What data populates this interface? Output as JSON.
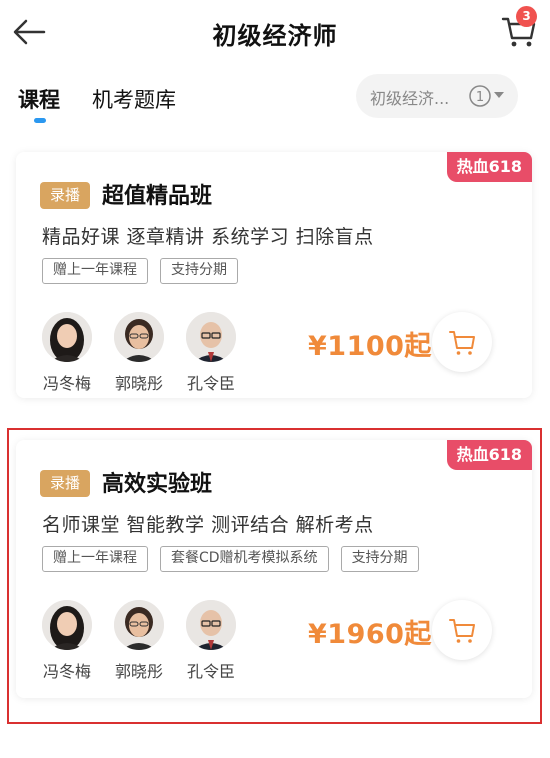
{
  "header": {
    "title": "初级经济师",
    "cart_count": "3"
  },
  "tabs": [
    {
      "label": "课程",
      "active": true
    },
    {
      "label": "机考题库",
      "active": false
    }
  ],
  "exam_filter": {
    "value": "初级经济...",
    "icon_text": "1"
  },
  "accent_colors": {
    "promo": "#e84d68",
    "live_tag": "#d9a560",
    "price": "#f08a3a",
    "tab_indicator": "#2b98f0"
  },
  "courses": [
    {
      "promo": "热血618",
      "tag": "录播",
      "name": "超值精品班",
      "description": "精品好课 逐章精讲 系统学习 扫除盲点",
      "features": [
        "赠上一年课程",
        "支持分期"
      ],
      "teachers": [
        {
          "name": "冯冬梅"
        },
        {
          "name": "郭晓彤"
        },
        {
          "name": "孔令臣"
        }
      ],
      "price": "¥1100起"
    },
    {
      "promo": "热血618",
      "tag": "录播",
      "name": "高效实验班",
      "description": "名师课堂 智能教学 测评结合 解析考点",
      "features": [
        "赠上一年课程",
        "套餐CD赠机考模拟系统",
        "支持分期"
      ],
      "teachers": [
        {
          "name": "冯冬梅"
        },
        {
          "name": "郭晓彤"
        },
        {
          "name": "孔令臣"
        }
      ],
      "price": "¥1960起"
    }
  ]
}
